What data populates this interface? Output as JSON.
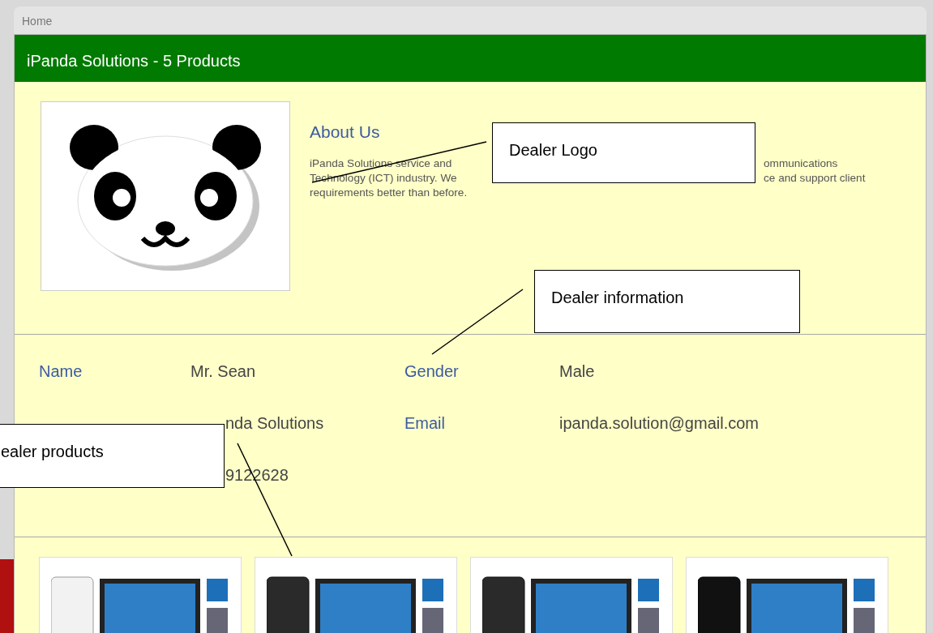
{
  "breadcrumb": "Home",
  "header": {
    "title": "iPanda Solutions - 5 Products"
  },
  "about": {
    "heading": "About Us",
    "lines": [
      [
        "iPanda Solutions service and",
        "ommunications"
      ],
      [
        "Technology (ICT) industry. We",
        "ce and support client"
      ],
      [
        "requirements better than before."
      ]
    ]
  },
  "info": {
    "rows": [
      {
        "kind": "full",
        "label": "Name",
        "value": "Mr. Sean",
        "label_2": "Gender",
        "value_2": "Male"
      },
      {
        "kind": "covered",
        "value": "nda Solutions",
        "label_2": "Email",
        "value_2": "ipanda.solution@gmail.com"
      },
      {
        "kind": "covered",
        "value": "9122628"
      }
    ]
  },
  "products": [
    {
      "kind": "white-case"
    },
    {
      "kind": "dark-case"
    },
    {
      "kind": "dark-case"
    },
    {
      "kind": "black-case"
    }
  ],
  "callouts": [
    {
      "text": "Dealer Logo"
    },
    {
      "text": "Dealer information"
    },
    {
      "text": "ealer products"
    }
  ]
}
